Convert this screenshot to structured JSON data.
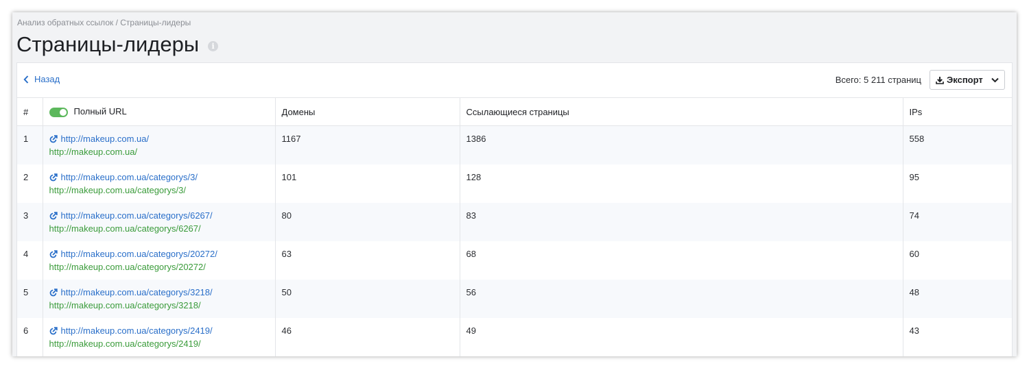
{
  "breadcrumb": "Анализ обратных ссылок / Страницы-лидеры",
  "page_title": "Страницы-лидеры",
  "toolbar": {
    "back_label": "Назад",
    "total_label": "Всего: 5 211 страниц",
    "export_label": "Экспорт"
  },
  "table": {
    "headers": {
      "num": "#",
      "url": "Полный URL",
      "domains": "Домены",
      "ref_pages": "Ссылающиеся страницы",
      "ips": "IPs"
    },
    "full_url_toggle_on": true,
    "rows": [
      {
        "num": "1",
        "link": "http://makeup.com.ua/",
        "full": "http://makeup.com.ua/",
        "domains": "1167",
        "ref_pages": "1386",
        "ips": "558"
      },
      {
        "num": "2",
        "link": "http://makeup.com.ua/categorys/3/",
        "full": "http://makeup.com.ua/categorys/3/",
        "domains": "101",
        "ref_pages": "128",
        "ips": "95"
      },
      {
        "num": "3",
        "link": "http://makeup.com.ua/categorys/6267/",
        "full": "http://makeup.com.ua/categorys/6267/",
        "domains": "80",
        "ref_pages": "83",
        "ips": "74"
      },
      {
        "num": "4",
        "link": "http://makeup.com.ua/categorys/20272/",
        "full": "http://makeup.com.ua/categorys/20272/",
        "domains": "63",
        "ref_pages": "68",
        "ips": "60"
      },
      {
        "num": "5",
        "link": "http://makeup.com.ua/categorys/3218/",
        "full": "http://makeup.com.ua/categorys/3218/",
        "domains": "50",
        "ref_pages": "56",
        "ips": "48"
      },
      {
        "num": "6",
        "link": "http://makeup.com.ua/categorys/2419/",
        "full": "http://makeup.com.ua/categorys/2419/",
        "domains": "46",
        "ref_pages": "49",
        "ips": "43"
      }
    ]
  },
  "colors": {
    "link": "#2a6fc9",
    "full_url": "#3a9b3a",
    "toggle": "#5cb85c"
  }
}
